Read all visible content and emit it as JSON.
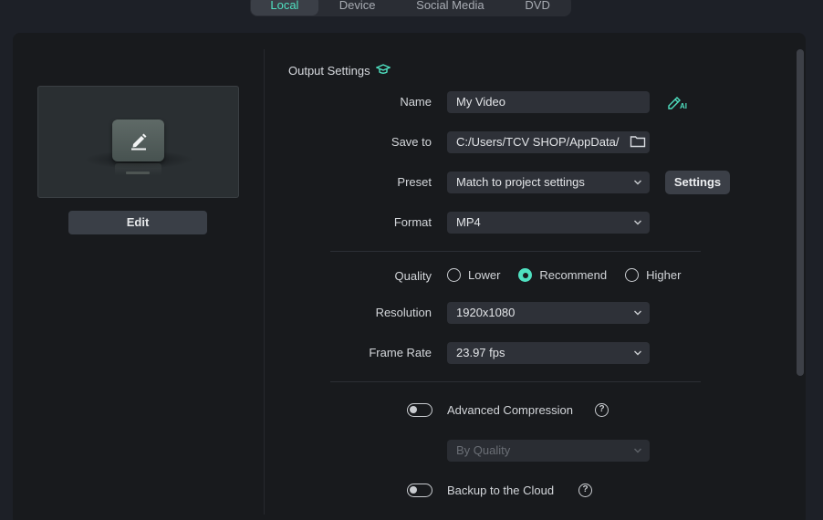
{
  "tabs": [
    {
      "label": "Local",
      "active": true
    },
    {
      "label": "Device",
      "active": false
    },
    {
      "label": "Social Media",
      "active": false
    },
    {
      "label": "DVD",
      "active": false
    }
  ],
  "preview": {
    "edit_label": "Edit",
    "icon": "pencil-icon"
  },
  "output": {
    "title": "Output Settings",
    "title_icon": "graduation-cap-icon",
    "name": {
      "label": "Name",
      "value": "My Video",
      "ai_icon": "ai-rename-icon"
    },
    "save_to": {
      "label": "Save to",
      "value": "C:/Users/TCV SHOP/AppData/",
      "icon": "folder-icon"
    },
    "preset": {
      "label": "Preset",
      "value": "Match to project settings",
      "settings_label": "Settings"
    },
    "format": {
      "label": "Format",
      "value": "MP4"
    },
    "quality": {
      "label": "Quality",
      "options": [
        {
          "label": "Lower",
          "selected": false
        },
        {
          "label": "Recommend",
          "selected": true
        },
        {
          "label": "Higher",
          "selected": false
        }
      ]
    },
    "resolution": {
      "label": "Resolution",
      "value": "1920x1080"
    },
    "frame_rate": {
      "label": "Frame Rate",
      "value": "23.97 fps"
    },
    "advanced_compression": {
      "label": "Advanced Compression",
      "enabled": false,
      "mode": "By Quality"
    },
    "backup_cloud": {
      "label": "Backup to the Cloud",
      "enabled": false
    }
  },
  "colors": {
    "accent": "#4fe0c0",
    "background": "#1d2027",
    "panel": "#181a1d"
  }
}
